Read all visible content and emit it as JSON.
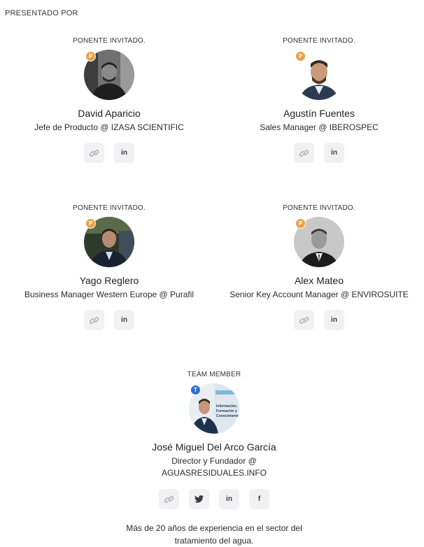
{
  "section_title": "PRESENTADO POR",
  "colors": {
    "badge_guest": "#e8a24a",
    "badge_team": "#2f6fd1",
    "button_bg": "#f1f1f4"
  },
  "speakers": [
    {
      "role": "PONENTE INVITADO.",
      "badge": "P",
      "name": "David Aparicio",
      "title": "Jefe de Producto @ IZASA SCIENTIFIC"
    },
    {
      "role": "PONENTE INVITADO.",
      "badge": "P",
      "name": "Agustín Fuentes",
      "title": "Sales Manager @ IBEROSPEC"
    },
    {
      "role": "PONENTE INVITADO.",
      "badge": "P",
      "name": "Yago Reglero",
      "title": "Business Manager Western Europe @ Purafil"
    },
    {
      "role": "PONENTE INVITADO.",
      "badge": "P",
      "name": "Alex Mateo",
      "title": "Senior Key Account Manager @ ENVIROSUITE"
    }
  ],
  "team_member": {
    "role": "TEAM MEMBER",
    "badge": "T",
    "name": "José Miguel Del Arco García",
    "title_line1": "Director y Fundador @",
    "title_line2": "AGUASRESIDUALES.INFO",
    "bio": "Más de 20 años de experiencia en el sector del tratamiento del agua.",
    "poster_text": "Información, Formación y Conocimiento"
  },
  "icons": {
    "link": "link-icon",
    "linkedin": "linkedin-icon",
    "twitter": "twitter-icon",
    "facebook": "facebook-icon"
  },
  "linkedin_label": "in",
  "facebook_label": "f"
}
